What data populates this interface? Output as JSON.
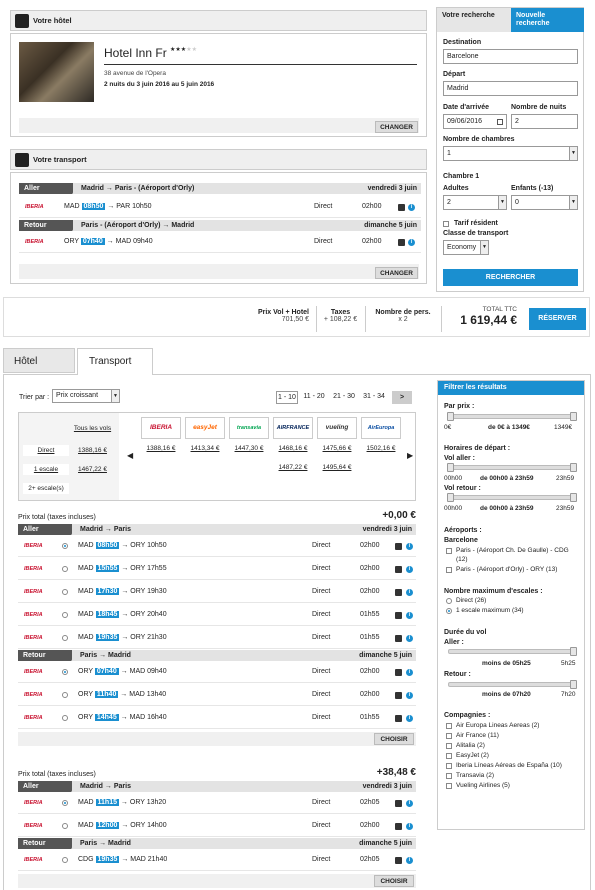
{
  "hotel_section": {
    "title": "Votre hôtel",
    "name": "Hotel Inn Fr",
    "stars": "★★★",
    "stars_off": "★★",
    "address": "38 avenue de l'Opera",
    "stay": "2 nuits du 3 juin 2016 au 5 juin 2016",
    "change": "CHANGER"
  },
  "transport_section": {
    "title": "Votre transport",
    "change": "CHANGER",
    "outbound": {
      "label": "Aller",
      "route": "Madrid → Paris - (Aéroport d'Orly)",
      "date": "vendredi 3 juin",
      "airline": "IBERIA",
      "from": "MAD",
      "dep": "08h50",
      "to": "PAR 10h50",
      "type": "Direct",
      "duration": "02h00"
    },
    "inbound": {
      "label": "Retour",
      "route": "Paris - (Aéroport d'Orly) → Madrid",
      "date": "dimanche 5 juin",
      "airline": "IBERIA",
      "from": "ORY",
      "dep": "07h40",
      "to": "MAD 09h40",
      "type": "Direct",
      "duration": "02h00"
    }
  },
  "summary": {
    "vol_label": "Prix Vol + Hotel",
    "vol_value": "701,50 €",
    "tax_label": "Taxes",
    "tax_value": "+ 108,22 €",
    "pers_label": "Nombre de pers.",
    "pers_value": "x 2",
    "total_label": "TOTAL TTC",
    "total_value": "1 619,44 €",
    "reserve": "RÉSERVER"
  },
  "search": {
    "tab1": "Votre recherche",
    "tab2": "Nouvelle recherche",
    "dest_label": "Destination",
    "dest": "Barcelone",
    "dep_label": "Départ",
    "dep": "Madrid",
    "arr_label": "Date d'arrivée",
    "arr": "09/06/2016",
    "nights_label": "Nombre de nuits",
    "nights": "2",
    "rooms_label": "Nombre de chambres",
    "rooms": "1",
    "room1": "Chambre 1",
    "adults_label": "Adultes",
    "adults": "2",
    "children_label": "Enfants (-13)",
    "children": "0",
    "resident": "Tarif résident",
    "class_label": "Classe de transport",
    "class": "Economy",
    "submit": "RECHERCHER"
  },
  "tabs": {
    "hotel": "Hôtel",
    "transport": "Transport"
  },
  "sort": {
    "label": "Trier par :",
    "value": "Prix croissant"
  },
  "pager": {
    "items": [
      "1 - 10",
      "11 - 20",
      "21 - 30",
      "31 - 34"
    ],
    "next": ">"
  },
  "matrix": {
    "all": "Tous les vols",
    "rows": [
      "Direct",
      "1 escale",
      "2+ escale(s)"
    ],
    "all_prices": [
      "1388,16 €",
      "1467,22 €"
    ],
    "airlines": [
      "IBERIA",
      "easyJet",
      "transavia",
      "AIRFRANCE",
      "vueling",
      "AirEuropa"
    ],
    "direct": [
      "1388,16 €",
      "1413,34 €",
      "1447,30 €",
      "1468,16 €",
      "1475,66 €",
      "1502,16 €"
    ],
    "stop": [
      "",
      "",
      "",
      "1487,22 €",
      "1495,64 €",
      ""
    ]
  },
  "results": [
    {
      "total_label": "Prix total (taxes incluses)",
      "delta": "+0,00 €",
      "out": {
        "label": "Aller",
        "route": "Madrid → Paris",
        "date": "vendredi 3 juin",
        "rows": [
          {
            "from": "MAD",
            "dep": "08h50",
            "arr": "ORY 10h50",
            "type": "Direct",
            "dur": "02h00",
            "sel": true
          },
          {
            "from": "MAD",
            "dep": "15h55",
            "arr": "ORY 17h55",
            "type": "Direct",
            "dur": "02h00"
          },
          {
            "from": "MAD",
            "dep": "17h30",
            "arr": "ORY 19h30",
            "type": "Direct",
            "dur": "02h00"
          },
          {
            "from": "MAD",
            "dep": "18h45",
            "arr": "ORY 20h40",
            "type": "Direct",
            "dur": "01h55"
          },
          {
            "from": "MAD",
            "dep": "19h35",
            "arr": "ORY 21h30",
            "type": "Direct",
            "dur": "01h55"
          }
        ]
      },
      "ret": {
        "label": "Retour",
        "route": "Paris → Madrid",
        "date": "dimanche 5 juin",
        "rows": [
          {
            "from": "ORY",
            "dep": "07h40",
            "arr": "MAD 09h40",
            "type": "Direct",
            "dur": "02h00",
            "sel": true
          },
          {
            "from": "ORY",
            "dep": "11h40",
            "arr": "MAD 13h40",
            "type": "Direct",
            "dur": "02h00"
          },
          {
            "from": "ORY",
            "dep": "14h45",
            "arr": "MAD 16h40",
            "type": "Direct",
            "dur": "01h55"
          }
        ]
      },
      "choose": "CHOISIR"
    },
    {
      "total_label": "Prix total (taxes incluses)",
      "delta": "+38,48 €",
      "out": {
        "label": "Aller",
        "route": "Madrid → Paris",
        "date": "vendredi 3 juin",
        "rows": [
          {
            "from": "MAD",
            "dep": "11h15",
            "arr": "ORY 13h20",
            "type": "Direct",
            "dur": "02h05",
            "sel": true
          },
          {
            "from": "MAD",
            "dep": "12h00",
            "arr": "ORY 14h00",
            "type": "Direct",
            "dur": "02h00"
          }
        ]
      },
      "ret": {
        "label": "Retour",
        "route": "Paris → Madrid",
        "date": "dimanche 5 juin",
        "rows": [
          {
            "from": "CDG",
            "dep": "19h35",
            "arr": "MAD 21h40",
            "type": "Direct",
            "dur": "02h05"
          }
        ]
      },
      "choose": "CHOISIR"
    }
  ],
  "filters": {
    "title": "Filtrer les résultats",
    "price_label": "Par prix :",
    "price_min": "0€",
    "price_range": "de 0€ à 1349€",
    "price_max": "1349€",
    "hours_label": "Horaires de départ :",
    "aller_label": "Vol aller :",
    "h_min": "00h00",
    "h_range": "de 00h00 à 23h59",
    "h_max": "23h59",
    "retour_label": "Vol retour :",
    "airports_label": "Aéroports :",
    "airports_city": "Barcelone",
    "airports": [
      "Paris - (Aéroport Ch. De Gaulle) - CDG (12)",
      "Paris - (Aéroport d'Orly) - ORY (13)"
    ],
    "stops_label": "Nombre maximum d'escales :",
    "stops": [
      "Direct (26)",
      "1 escale maximum (34)"
    ],
    "duration_label": "Durée du vol",
    "d_aller": "Aller :",
    "d_aller_txt": "moins de 05h25",
    "d_aller_max": "5h25",
    "d_retour": "Retour :",
    "d_retour_txt": "moins de 07h20",
    "d_retour_max": "7h20",
    "companies_label": "Compagnies :",
    "companies": [
      "Air Europa Lineas Aereas (2)",
      "Air France (11)",
      "Alitalia (2)",
      "EasyJet (2)",
      "Iberia Líneas Aéreas de España (10)",
      "Transavia (2)",
      "Vueling Airlines (5)"
    ]
  },
  "colors": {
    "accent": "#1a8fd0",
    "iberia": "#c8102e"
  }
}
